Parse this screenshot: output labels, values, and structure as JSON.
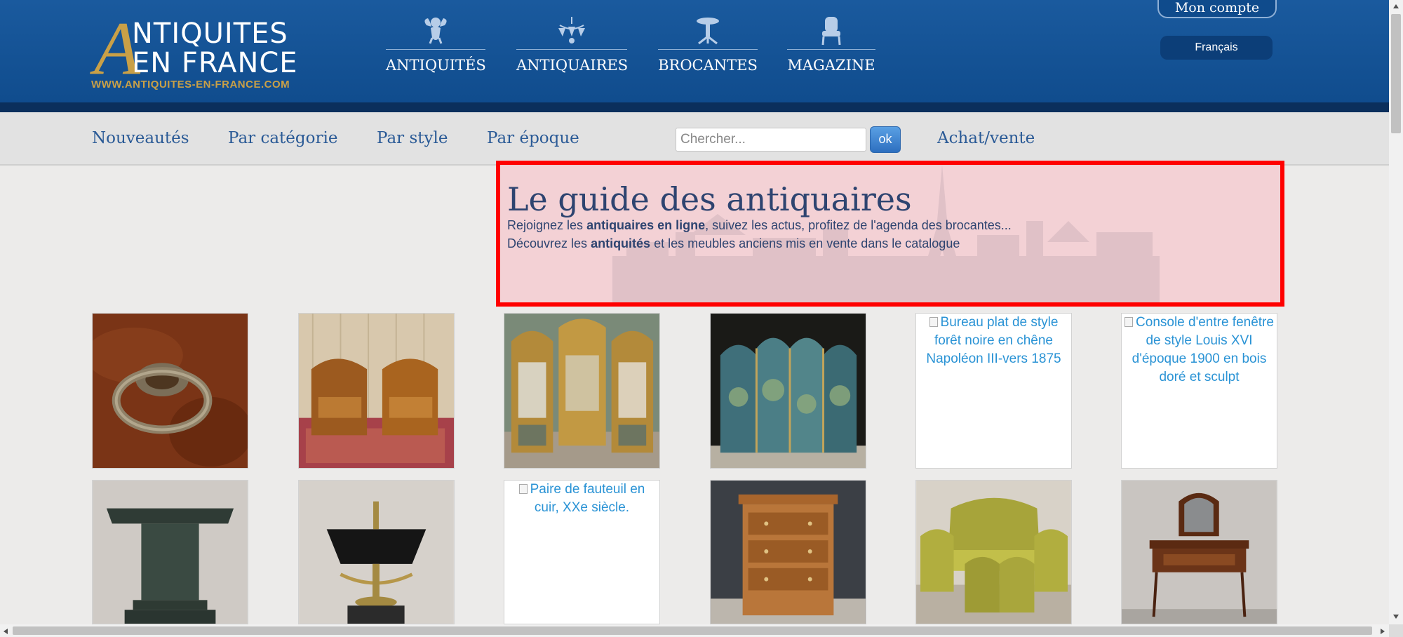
{
  "header": {
    "logo_line1": "NTIQUITES",
    "logo_line2": "EN FRANCE",
    "logo_big_letter": "A",
    "logo_url": "WWW.ANTIQUITES-EN-FRANCE.COM",
    "account_label": "Mon compte",
    "language_label": "Français",
    "main_nav": [
      {
        "label": "ANTIQUITÉS",
        "icon": "cherub-icon"
      },
      {
        "label": "ANTIQUAIRES",
        "icon": "chandelier-icon"
      },
      {
        "label": "BROCANTES",
        "icon": "pedestal-table-icon"
      },
      {
        "label": "MAGAZINE",
        "icon": "armchair-icon"
      }
    ]
  },
  "subnav": {
    "links": [
      "Nouveautés",
      "Par catégorie",
      "Par style",
      "Par époque"
    ],
    "search_placeholder": "Chercher...",
    "ok_label": "ok",
    "achat_label": "Achat/vente"
  },
  "guide": {
    "title": "Le guide des antiquaires",
    "line1_pre": "Rejoignez les ",
    "line1_bold": "antiquaires en ligne",
    "line1_post": ", suivez les actus, profitez de l'agenda des brocantes...",
    "line2_pre": "Découvrez les ",
    "line2_bold": "antiquités",
    "line2_post": " et les meubles anciens mis en vente dans le catalogue"
  },
  "products": [
    {
      "kind": "image",
      "subject": "bronze-handle",
      "alt": ""
    },
    {
      "kind": "image",
      "subject": "leather-club-chairs",
      "alt": ""
    },
    {
      "kind": "image",
      "subject": "gilded-screen",
      "alt": ""
    },
    {
      "kind": "image",
      "subject": "painted-folding-screen",
      "alt": ""
    },
    {
      "kind": "broken",
      "subject": "",
      "alt": "Bureau plat de style forêt noire en chêne Napoléon III-vers 1875"
    },
    {
      "kind": "broken",
      "subject": "",
      "alt": "Console d'entre fenêtre de style Louis XVI d'époque 1900 en bois doré et sculpt"
    },
    {
      "kind": "image",
      "subject": "marble-pedestal",
      "alt": ""
    },
    {
      "kind": "image",
      "subject": "bouillotte-lamp",
      "alt": ""
    },
    {
      "kind": "broken",
      "subject": "",
      "alt": "Paire de fauteuil en cuir, XXe siècle."
    },
    {
      "kind": "image",
      "subject": "wooden-chest-of-drawers",
      "alt": ""
    },
    {
      "kind": "image",
      "subject": "yellow-salon-set",
      "alt": ""
    },
    {
      "kind": "image",
      "subject": "dressing-table",
      "alt": ""
    }
  ]
}
